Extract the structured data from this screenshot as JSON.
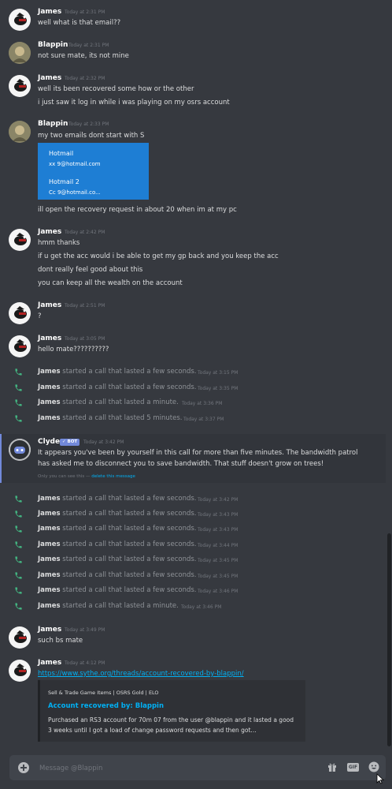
{
  "messages": [
    {
      "author": "James",
      "time": "Today at 2:31 PM",
      "lines": [
        "well what is that email??"
      ]
    },
    {
      "author": "Blappin",
      "time": "Today at 2:31 PM",
      "lines": [
        "not sure mate, its not mine"
      ]
    },
    {
      "author": "James",
      "time": "Today at 2:32 PM",
      "lines": [
        "well its been recovered some how or the other",
        "i just saw it log in while i was playing on my osrs account"
      ]
    },
    {
      "author": "Blappin",
      "time": "Today at 2:33 PM",
      "lines": [
        "my two emails dont start with S",
        "ill open the recovery request in about 20 when im at my pc"
      ],
      "image": {
        "title1": "Hotmail",
        "sub1": "xx            9@hotmail.com",
        "title2": "Hotmail 2",
        "sub2": "Cc            9@hotmail.co..."
      }
    },
    {
      "author": "James",
      "time": "Today at 2:42 PM",
      "lines": [
        "hmm thanks",
        "if u get the acc would i be able to get my gp back and you keep the acc",
        "dont really feel good about this",
        "you can keep all the wealth on the account"
      ]
    },
    {
      "author": "James",
      "time": "Today at 2:51 PM",
      "lines": [
        "?"
      ]
    },
    {
      "author": "James",
      "time": "Today at 3:05 PM",
      "lines": [
        "hello mate??????????"
      ]
    },
    {
      "author": "Clyde",
      "badge": "✓ BOT",
      "time": "Today at 3:42 PM",
      "lines": [
        "It appears you've been by yourself in this call for more than five minutes. The bandwidth patrol",
        "has asked me to disconnect you to save bandwidth. That stuff doesn't grow on trees!"
      ],
      "notice": "Only you can see this —",
      "notice_link": "delete this message"
    },
    {
      "author": "James",
      "time": "Today at 3:49 PM",
      "lines": [
        "such bs mate"
      ]
    },
    {
      "author": "James",
      "time": "Today at 4:12 PM",
      "link": "https://www.sythe.org/threads/account-recovered-by-blappin/",
      "embed": {
        "provider": "Sell & Trade Game Items | OSRS Gold | ELO",
        "title": "Account recovered by: Blappin",
        "desc1": "Purchased an RS3 account for 70m 07 from the user @blappin and it lasted a good",
        "desc2": "3 weeks until I got a load of change password requests and then got..."
      }
    }
  ],
  "calls_a": [
    {
      "author": "James",
      "text": "started a call that lasted a few seconds.",
      "time": "Today at 3:15 PM"
    },
    {
      "author": "James",
      "text": "started a call that lasted a few seconds.",
      "time": "Today at 3:35 PM"
    },
    {
      "author": "James",
      "text": "started a call that lasted a minute.",
      "time": "Today at 3:36 PM"
    },
    {
      "author": "James",
      "text": "started a call that lasted 5 minutes.",
      "time": "Today at 3:37 PM"
    }
  ],
  "calls_b": [
    {
      "author": "James",
      "text": "started a call that lasted a few seconds.",
      "time": "Today at 3:42 PM"
    },
    {
      "author": "James",
      "text": "started a call that lasted a few seconds.",
      "time": "Today at 3:43 PM"
    },
    {
      "author": "James",
      "text": "started a call that lasted a few seconds.",
      "time": "Today at 3:43 PM"
    },
    {
      "author": "James",
      "text": "started a call that lasted a few seconds.",
      "time": "Today at 3:44 PM"
    },
    {
      "author": "James",
      "text": "started a call that lasted a few seconds.",
      "time": "Today at 3:45 PM"
    },
    {
      "author": "James",
      "text": "started a call that lasted a few seconds.",
      "time": "Today at 3:45 PM"
    },
    {
      "author": "James",
      "text": "started a call that lasted a few seconds.",
      "time": "Today at 3:46 PM"
    },
    {
      "author": "James",
      "text": "started a call that lasted a minute.",
      "time": "Today at 3:46 PM"
    }
  ],
  "composer": {
    "placeholder": "Message @Blappin",
    "gif_label": "GIF"
  },
  "colors": {
    "background": "#36393f",
    "link": "#00b0f4",
    "call_green": "#43b581",
    "bot_badge": "#7289da",
    "hotmail_blue": "#1e7ed4"
  }
}
